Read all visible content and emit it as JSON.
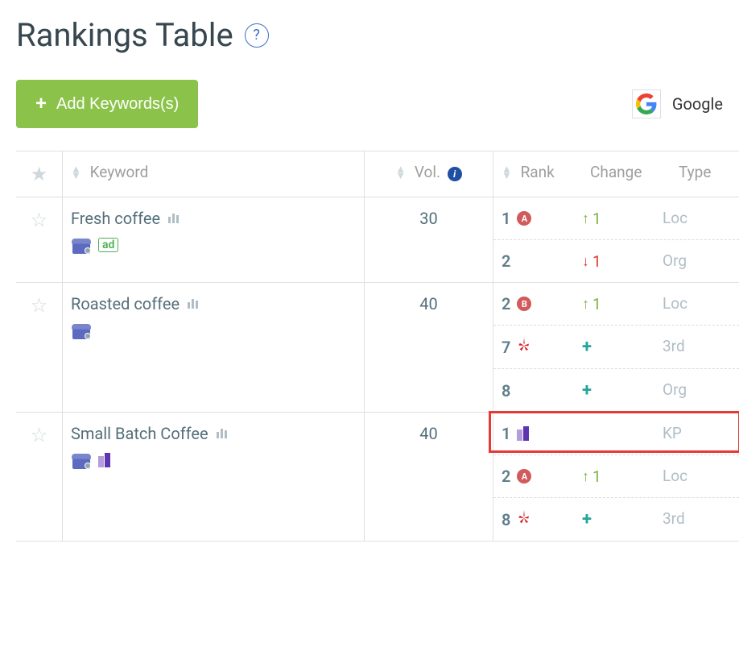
{
  "title": "Rankings Table",
  "help_label": "?",
  "add_button_label": "Add Keywords(s)",
  "engine": {
    "name": "Google"
  },
  "columns": {
    "keyword": "Keyword",
    "vol": "Vol.",
    "rank": "Rank",
    "change": "Change",
    "type": "Type"
  },
  "rows": [
    {
      "keyword": "Fresh coffee",
      "show_ad": true,
      "show_kp": false,
      "vol": "30",
      "ranks": [
        {
          "rank": "1",
          "badge": "A",
          "change_dir": "up",
          "change_val": "1",
          "type": "Loc",
          "highlight": false,
          "mark": "circ"
        },
        {
          "rank": "2",
          "badge": "",
          "change_dir": "down",
          "change_val": "1",
          "type": "Org",
          "highlight": false,
          "mark": ""
        }
      ]
    },
    {
      "keyword": "Roasted coffee",
      "show_ad": false,
      "show_kp": false,
      "vol": "40",
      "ranks": [
        {
          "rank": "2",
          "badge": "B",
          "change_dir": "up",
          "change_val": "1",
          "type": "Loc",
          "highlight": false,
          "mark": "circ"
        },
        {
          "rank": "7",
          "badge": "",
          "change_dir": "plus",
          "change_val": "",
          "type": "3rd",
          "highlight": false,
          "mark": "yelp"
        },
        {
          "rank": "8",
          "badge": "",
          "change_dir": "plus",
          "change_val": "",
          "type": "Org",
          "highlight": false,
          "mark": ""
        }
      ]
    },
    {
      "keyword": "Small Batch Coffee",
      "show_ad": false,
      "show_kp": true,
      "vol": "40",
      "ranks": [
        {
          "rank": "1",
          "badge": "",
          "change_dir": "",
          "change_val": "",
          "type": "KP",
          "highlight": true,
          "mark": "kp"
        },
        {
          "rank": "2",
          "badge": "A",
          "change_dir": "up",
          "change_val": "1",
          "type": "Loc",
          "highlight": false,
          "mark": "circ"
        },
        {
          "rank": "8",
          "badge": "",
          "change_dir": "plus",
          "change_val": "",
          "type": "3rd",
          "highlight": false,
          "mark": "yelp"
        }
      ]
    }
  ]
}
